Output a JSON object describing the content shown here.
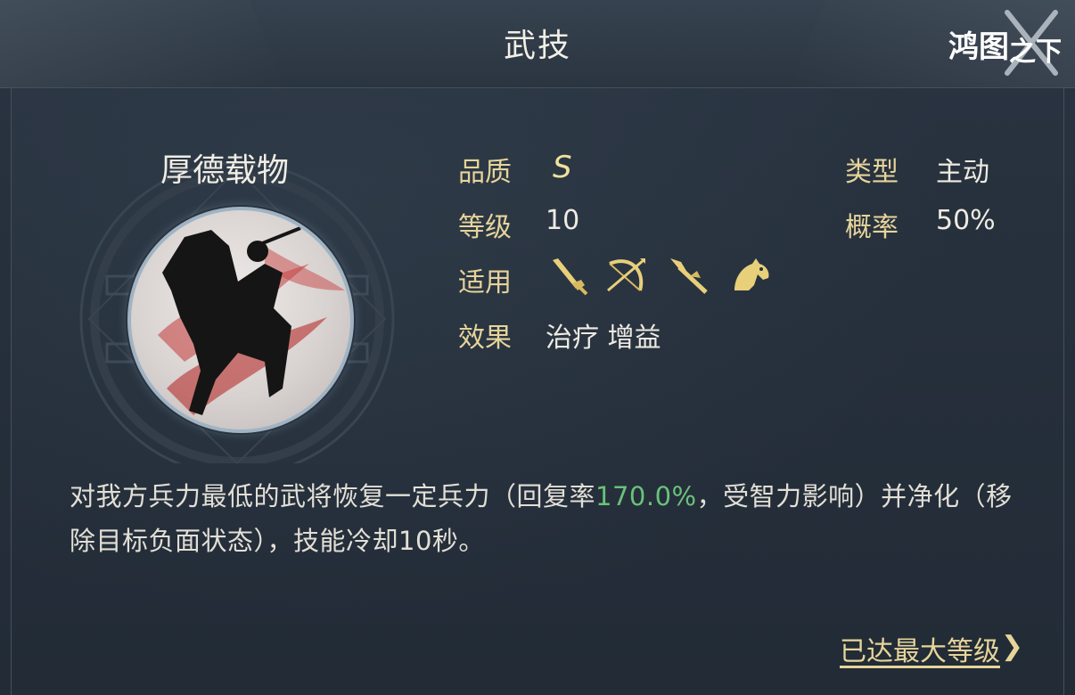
{
  "header": {
    "title": "武技",
    "logo_text": "鸿图之下"
  },
  "skill": {
    "name": "厚德载物",
    "quality_label": "品质",
    "quality_value": "S",
    "level_label": "等级",
    "level_value": "10",
    "apply_label": "适用",
    "apply_icons": [
      "sword-icon",
      "bow-icon",
      "spear-icon",
      "horse-icon"
    ],
    "effect_label": "效果",
    "effect_value": "治疗 增益",
    "type_label": "类型",
    "type_value": "主动",
    "chance_label": "概率",
    "chance_value": "50%"
  },
  "description": {
    "part1": "对我方兵力最低的武将恢复一定兵力（回复率",
    "highlight": "170.0%",
    "part2": "，受智力影响）并净化（移除目标负面状态），技能冷却10秒。"
  },
  "footer": {
    "max_level_link": "已达最大等级",
    "chevron": "❯"
  },
  "colors": {
    "label_gold": "#e6d49a",
    "highlight_green": "#69c27a",
    "background": "#26303c"
  }
}
